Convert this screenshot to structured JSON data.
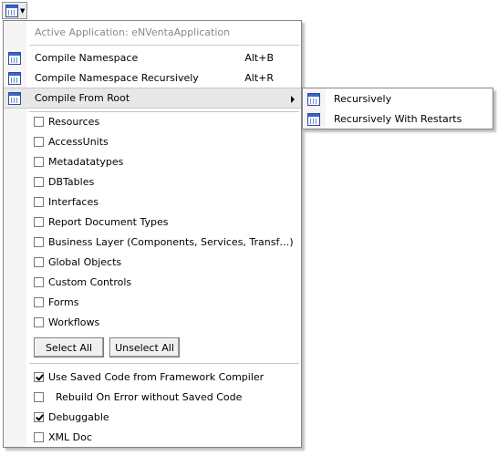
{
  "menu": {
    "caption": "Active Application: eNVentaApplication",
    "commands": [
      {
        "label": "Compile Namespace",
        "shortcut": "Alt+B",
        "icon": "compile-icon"
      },
      {
        "label": "Compile Namespace Recursively",
        "shortcut": "Alt+R",
        "icon": "compile-icon"
      },
      {
        "label": "Compile From Root",
        "shortcut": "",
        "icon": "compile-icon",
        "has_submenu": true
      }
    ],
    "categories": [
      {
        "label": "Resources",
        "checked": false
      },
      {
        "label": "AccessUnits",
        "checked": false
      },
      {
        "label": "Metadatatypes",
        "checked": false
      },
      {
        "label": "DBTables",
        "checked": false
      },
      {
        "label": "Interfaces",
        "checked": false
      },
      {
        "label": "Report Document Types",
        "checked": false
      },
      {
        "label": "Business Layer (Components, Services, Transf…)",
        "checked": false
      },
      {
        "label": "Global Objects",
        "checked": false
      },
      {
        "label": "Custom Controls",
        "checked": false
      },
      {
        "label": "Forms",
        "checked": false
      },
      {
        "label": "Workflows",
        "checked": false
      }
    ],
    "select_all_label": "Select All",
    "unselect_all_label": "Unselect All",
    "options": [
      {
        "label": "Use Saved Code from Framework Compiler",
        "checked": true
      },
      {
        "label": "Rebuild On Error without Saved Code",
        "checked": false
      },
      {
        "label": "Debuggable",
        "checked": true
      },
      {
        "label": "XML Doc",
        "checked": false
      }
    ]
  },
  "submenu": {
    "items": [
      {
        "label": "Recursively",
        "icon": "compile-icon"
      },
      {
        "label": "Recursively With Restarts",
        "icon": "compile-icon"
      }
    ]
  },
  "colors": {
    "highlight": "#e8e8e8",
    "gutter": "#f5f5f5",
    "border": "#848484"
  }
}
